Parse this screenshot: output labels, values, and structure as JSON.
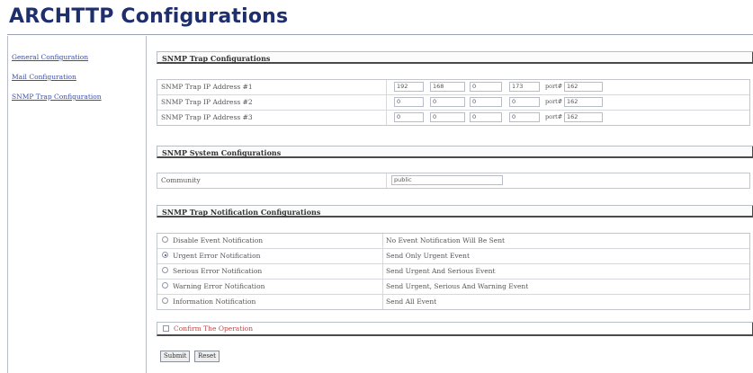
{
  "page": {
    "title": "ARCHTTP Configurations"
  },
  "sidebar": {
    "items": [
      {
        "label": "General Configuration"
      },
      {
        "label": "Mail Configuration"
      },
      {
        "label": "SNMP Trap Configuration"
      }
    ]
  },
  "snmp_trap": {
    "header": "SNMP Trap Configurations",
    "port_label": "port#",
    "rows": [
      {
        "label": "SNMP Trap IP Address #1",
        "ip": [
          "192",
          "168",
          "0",
          "173"
        ],
        "port": "162"
      },
      {
        "label": "SNMP Trap IP Address #2",
        "ip": [
          "0",
          "0",
          "0",
          "0"
        ],
        "port": "162"
      },
      {
        "label": "SNMP Trap IP Address #3",
        "ip": [
          "0",
          "0",
          "0",
          "0"
        ],
        "port": "162"
      }
    ]
  },
  "snmp_system": {
    "header": "SNMP System Configurations",
    "community_label": "Community",
    "community_value": "public"
  },
  "notification": {
    "header": "SNMP Trap Notification Configurations",
    "options": [
      {
        "label": "Disable Event Notification",
        "description": "No Event Notification Will Be Sent",
        "selected": false
      },
      {
        "label": "Urgent Error Notification",
        "description": "Send Only Urgent Event",
        "selected": true
      },
      {
        "label": "Serious Error Notification",
        "description": "Send Urgent And Serious Event",
        "selected": false
      },
      {
        "label": "Warning Error Notification",
        "description": "Send Urgent, Serious And Warning Event",
        "selected": false
      },
      {
        "label": "Information Notification",
        "description": "Send All Event",
        "selected": false
      }
    ]
  },
  "confirm": {
    "label": "Confirm The Operation"
  },
  "buttons": {
    "submit": "Submit",
    "reset": "Reset"
  }
}
